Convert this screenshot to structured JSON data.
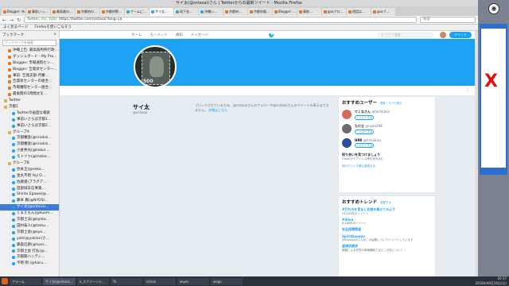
{
  "window": {
    "title": "サイ太(@sntasai)さん | Twitterからの最新ツイート - Mozilla Firefox"
  },
  "tabs": [
    {
      "label": "Blogger: 布…",
      "fav": "blogger"
    },
    {
      "label": "事前いっ…",
      "fav": "blogger"
    },
    {
      "label": "最高裁の…",
      "fav": "blogger"
    },
    {
      "label": "京都府の…",
      "fav": "blogger"
    },
    {
      "label": "京都府警…",
      "fav": "blogger"
    },
    {
      "label": "ゲームに…",
      "fav": "twitter"
    },
    {
      "label": "サイ太…",
      "fav": "twitter",
      "active": true
    },
    {
      "label": "琉下金…",
      "fav": "twitter"
    },
    {
      "label": "沖縄い…",
      "fav": "twitter"
    },
    {
      "label": "京都府…",
      "fav": "blogger"
    },
    {
      "label": "京都府裁…",
      "fav": "blogger"
    },
    {
      "label": "Blogger: …",
      "fav": "blogger"
    },
    {
      "label": "事前…",
      "fav": "blogger"
    },
    {
      "label": "gooブロ…",
      "fav": "blogger"
    },
    {
      "label": "遊話は…",
      "fav": "blogger"
    },
    {
      "label": "gooブ…",
      "fav": "blogger"
    }
  ],
  "navbar": {
    "back": "←",
    "forward": "→",
    "reload": "↻",
    "url_secure": "Twitter, Inc. (US)",
    "url": "https://twitter.com/sntasai?lang=ja",
    "search_placeholder": "検索"
  },
  "bookmarks_bar": [
    "よく見るページ",
    "Firefoxを使いこなそう"
  ],
  "sidebar": {
    "title": "ブックマーク",
    "close": "×",
    "search_placeholder": "ブックマークを検索",
    "items": [
      {
        "label": "沖縄上告: 最高裁判所行政…",
        "ico": "blogger",
        "indent": 2
      },
      {
        "label": "ダッシュボード - My Pro…",
        "ico": "blogger",
        "indent": 2
      },
      {
        "label": "Blogger: 市場通院セン…",
        "ico": "blogger",
        "indent": 2
      },
      {
        "label": "Blogger: 告発状センター…",
        "ico": "blogger",
        "indent": 2
      },
      {
        "label": "事前: 告発支部-月審…",
        "ico": "blogger",
        "indent": 2
      },
      {
        "label": "告発状センターの組合…",
        "ico": "blogger",
        "indent": 2
      },
      {
        "label": "市場審院センター組合…",
        "ico": "blogger",
        "indent": 2
      },
      {
        "label": "最後閲の1時間文を…",
        "ico": "blogger",
        "indent": 2
      },
      {
        "label": "Twitter",
        "ico": "folder",
        "indent": 1
      },
      {
        "label": "京都1",
        "ico": "folder",
        "indent": 1
      },
      {
        "label": "Twitterの画面な検索",
        "ico": "twitter",
        "indent": 3
      },
      {
        "label": "事前いさらば京都1…",
        "ico": "twitter",
        "indent": 3
      },
      {
        "label": "事前いさらば京都2…",
        "ico": "twitter",
        "indent": 3
      },
      {
        "label": "グループA",
        "ico": "folder",
        "indent": 2
      },
      {
        "label": "京都審査(@sriukai…",
        "ico": "twitter",
        "indent": 3
      },
      {
        "label": "京都審査(@sriukai…",
        "ico": "twitter",
        "indent": 3
      },
      {
        "label": "小倉秀光(@kokur…",
        "ico": "twitter",
        "indent": 3
      },
      {
        "label": "モトツゥ(@motoc…",
        "ico": "twitter",
        "indent": 3
      },
      {
        "label": "グループB",
        "ico": "folder",
        "indent": 2
      },
      {
        "label": "弥本王(@neko…",
        "ico": "twitter",
        "indent": 3
      },
      {
        "label": "金丸不明 Yoji O…",
        "ico": "twitter",
        "indent": 3
      },
      {
        "label": "佐藤俊(ブラグア…",
        "ico": "twitter",
        "indent": 3
      },
      {
        "label": "田部城去信事業…",
        "ico": "twitter",
        "indent": 3
      },
      {
        "label": "Shinto Egawa(@…",
        "ico": "twitter",
        "indent": 3
      },
      {
        "label": "藤本 鳳(@NYOSI…",
        "ico": "twitter",
        "indent": 3
      },
      {
        "label": "サイ太(@sntasai…",
        "ico": "twitter",
        "indent": 3,
        "selected": true
      },
      {
        "label": "くまえもん(@kuom…",
        "ico": "twitter",
        "indent": 3
      },
      {
        "label": "京都士法(@kyoto…",
        "ico": "twitter",
        "indent": 3
      },
      {
        "label": "田村泰人(@tamu…",
        "ico": "twitter",
        "indent": 3
      },
      {
        "label": "京都士会(@kyo…",
        "ico": "twitter",
        "indent": 3
      },
      {
        "label": "yoki(@yokion)さ…",
        "ico": "twitter",
        "indent": 3
      },
      {
        "label": "藤森信教(@hoss…",
        "ico": "twitter",
        "indent": 3
      },
      {
        "label": "京都士会 打払(@…",
        "ico": "twitter",
        "indent": 3
      },
      {
        "label": "京都関ハンディ…",
        "ico": "twitter",
        "indent": 3
      },
      {
        "label": "不明 明 (@haru…",
        "ico": "twitter",
        "indent": 3
      }
    ]
  },
  "twitter": {
    "nav": [
      "ホーム",
      "モーメント",
      "通知",
      "メッセージ"
    ],
    "search_placeholder": "キーワード検索",
    "tweet_button": "ツイート",
    "more": "⋮",
    "profile": {
      "name": "サイ太",
      "handle": "@sntasai",
      "avatar_value": "500"
    },
    "blocked": {
      "text": "ブロックされているため、@sntasaiさんのフォローや@sntasaiさんのツイートの表示はできません。",
      "link": "詳細はこちら"
    },
    "recommend": {
      "title": "おすすめユーザー",
      "refresh": "更新・すべて表示",
      "users": [
        {
          "name": "てくなさん",
          "handle": "@techtjiron",
          "follow": "フォローする",
          "color": "#d66a5a"
        },
        {
          "name": "たけ士",
          "handle": "@noiki2NE",
          "follow": "フォローする",
          "color": "#6b6b6b"
        },
        {
          "name": "HRK",
          "handle": "@hiroakisa",
          "follow": "フォローする",
          "color": "#2a4f9a"
        }
      ],
      "find_title": "知り合いを見つけましょう",
      "find_sub": "Gmailからアドレス帳を読み込む",
      "link": "他のアドレス帳に接続する"
    },
    "trends": {
      "title": "おすすめトレンド",
      "change": "変更する",
      "items": [
        {
          "name": "#打ち方を見ると名前を教えてみよう",
          "desc": "24,000件のツイート"
        },
        {
          "name": "#dlive",
          "desc": "8,468件のツイート"
        },
        {
          "name": "安全保障関連",
          "desc": ""
        },
        {
          "name": "Spiritboomix",
          "desc": "@Kinoshitaさんがこの話題についてツイートしています"
        },
        {
          "name": "逮捕状請求",
          "desc": "警察による任意の事情聴取でまたこの件について…"
        }
      ]
    }
  },
  "taskbar": {
    "tasks": [
      {
        "label": "アラーム",
        "active": false
      },
      {
        "label": "サイ太(@sntasa…",
        "active": true
      },
      {
        "label": "a_スクリーンシ…",
        "active": false
      },
      {
        "label": "Tk",
        "active": false
      },
      {
        "label": "sclock",
        "active": false
      },
      {
        "label": "xeyes",
        "active": false
      },
      {
        "label": "xlogo",
        "active": false
      }
    ],
    "clock_time": "20:37",
    "clock_date": "2018年09月16日(日)"
  }
}
